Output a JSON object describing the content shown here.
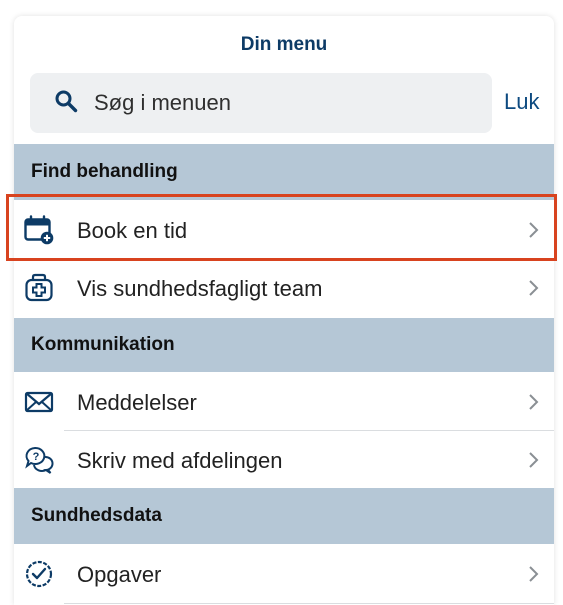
{
  "menu": {
    "title": "Din menu",
    "search_placeholder": "Søg i menuen",
    "close_label": "Luk"
  },
  "sections": [
    {
      "title": "Find behandling",
      "items": [
        {
          "label": "Book en tid",
          "icon": "calendar-add-icon"
        },
        {
          "label": "Vis sundhedsfagligt team",
          "icon": "medical-bag-icon"
        }
      ]
    },
    {
      "title": "Kommunikation",
      "items": [
        {
          "label": "Meddelelser",
          "icon": "envelope-icon"
        },
        {
          "label": "Skriv med afdelingen",
          "icon": "chat-question-icon"
        }
      ]
    },
    {
      "title": "Sundhedsdata",
      "items": [
        {
          "label": "Opgaver",
          "icon": "clock-check-icon"
        }
      ]
    }
  ],
  "colors": {
    "accent": "#0d3b66",
    "section_bg": "#b5c7d6",
    "highlight": "#d8431f"
  }
}
